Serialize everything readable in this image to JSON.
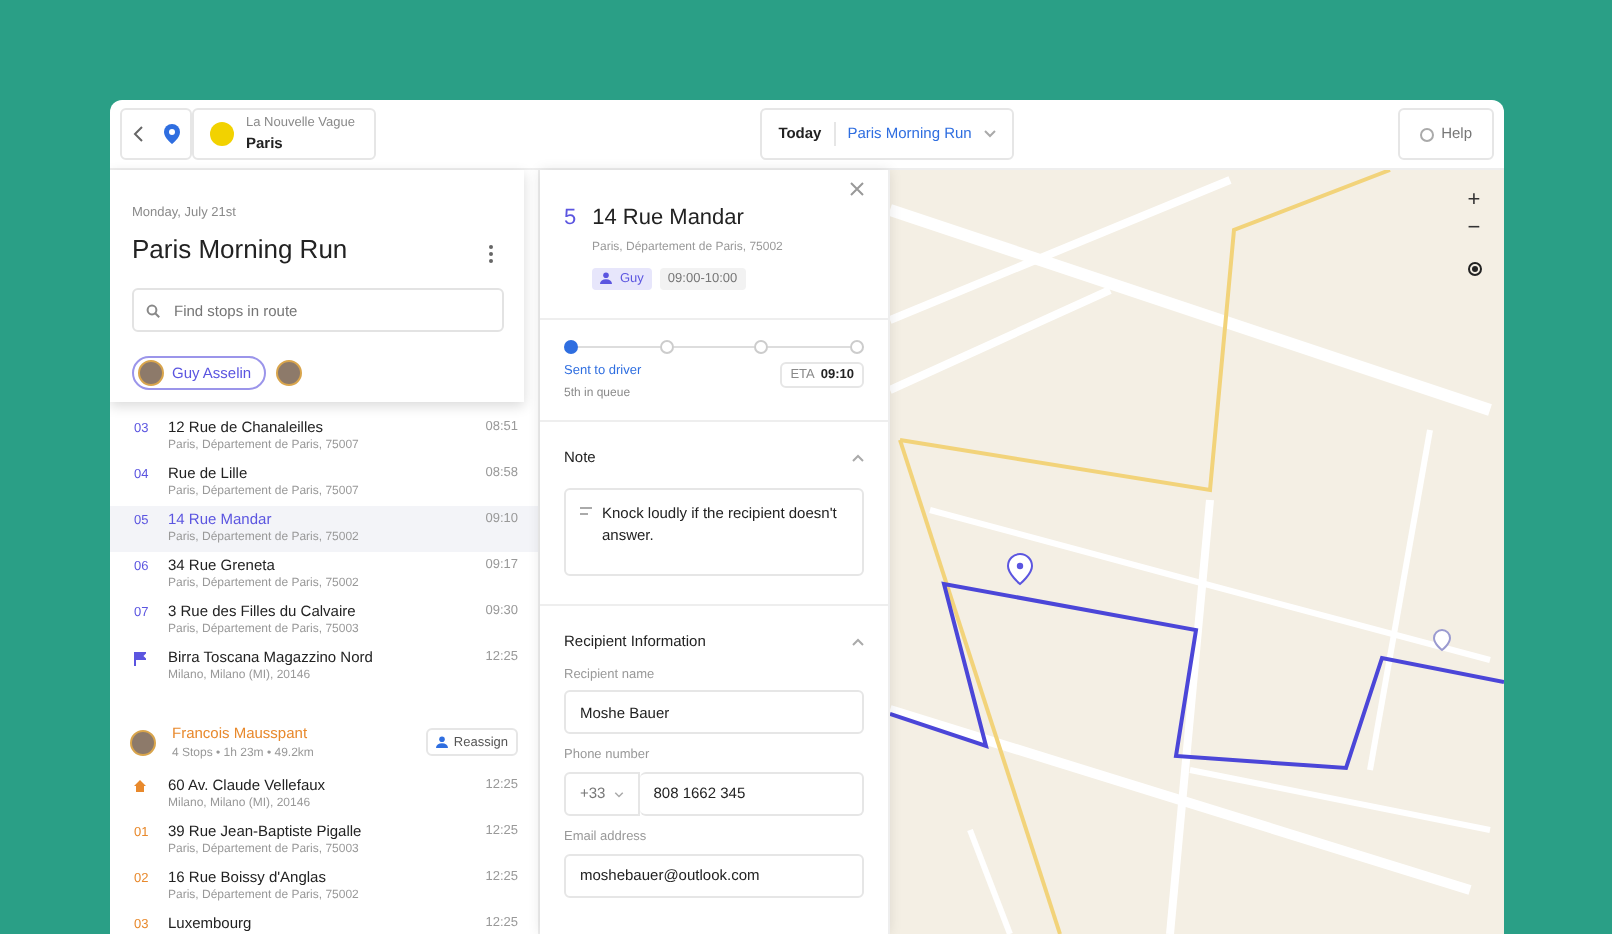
{
  "topbar": {
    "org_name": "La Nouvelle Vague",
    "org_city": "Paris",
    "day": "Today",
    "route_select": "Paris Morning Run",
    "help": "Help"
  },
  "route": {
    "date": "Monday, July 21st",
    "title": "Paris Morning Run",
    "search": {
      "placeholder": "Find stops in route"
    },
    "driver_filter": [
      {
        "label": "Guy Asselin",
        "selected": true
      },
      {
        "selected": false
      }
    ]
  },
  "groups": [
    {
      "color": "#5b55e0",
      "stops": [
        {
          "kind": "stop",
          "number": "03",
          "title": "12 Rue de Chanaleilles",
          "address": "Paris, Département de Paris, 75007",
          "time": "08:51",
          "selected": false
        },
        {
          "kind": "stop",
          "number": "04",
          "title": "Rue de Lille",
          "address": "Paris, Département de Paris, 75007",
          "time": "08:58",
          "selected": false
        },
        {
          "kind": "stop",
          "number": "05",
          "title": "14 Rue Mandar",
          "address": "Paris, Département de Paris, 75002",
          "time": "09:10",
          "selected": true
        },
        {
          "kind": "stop",
          "number": "06",
          "title": "34 Rue Greneta",
          "address": "Paris, Département de Paris, 75002",
          "time": "09:17",
          "selected": false
        },
        {
          "kind": "stop",
          "number": "07",
          "title": "3 Rue des Filles du Calvaire",
          "address": "Paris, Département de Paris, 75003",
          "time": "09:30",
          "selected": false
        },
        {
          "kind": "end",
          "title": "Birra Toscana Magazzino Nord",
          "address": "Milano, Milano (MI), 20146",
          "time": "12:25",
          "selected": false
        }
      ]
    },
    {
      "color": "#e8892c",
      "driver": "Francois Mausspant",
      "summary": "4 Stops • 1h 23m • 49.2km",
      "action": "Reassign",
      "stops": [
        {
          "kind": "start",
          "title": "60 Av. Claude Vellefaux",
          "address": "Milano, Milano (MI), 20146",
          "time": "12:25",
          "selected": false
        },
        {
          "kind": "stop",
          "number": "01",
          "title": "39 Rue Jean-Baptiste Pigalle",
          "address": "Paris, Département de Paris, 75003",
          "time": "12:25",
          "selected": false
        },
        {
          "kind": "stop",
          "number": "02",
          "title": "16 Rue Boissy d'Anglas",
          "address": "Paris, Département de Paris, 75002",
          "time": "12:25",
          "selected": false
        },
        {
          "kind": "stop",
          "number": "03",
          "title": "Luxembourg",
          "time": "12:25",
          "selected": false
        }
      ]
    }
  ],
  "detail": {
    "number": "5",
    "title": "14 Rue Mandar",
    "address": "Paris, Département de Paris, 75002",
    "driver_tag": "Guy",
    "time_window": "09:00-10:00",
    "steps": [
      {
        "done": true
      },
      {
        "done": false
      },
      {
        "done": false
      },
      {
        "done": false
      }
    ],
    "status": "Sent to driver",
    "queue": "5th in queue",
    "eta_label": "ETA",
    "eta": "09:10",
    "note": {
      "title": "Note",
      "expanded": true,
      "text": "Knock loudly if the recipient doesn't answer."
    },
    "recipient": {
      "title": "Recipient Information",
      "expanded": true,
      "fields": [
        {
          "kind": "text",
          "label": "Recipient name",
          "value": "Moshe Bauer"
        },
        {
          "kind": "phone",
          "label": "Phone number",
          "prefix": "+33",
          "value": "808 1662 345"
        },
        {
          "kind": "text",
          "label": "Email address",
          "value": "moshebauer@outlook.com"
        }
      ]
    }
  },
  "map": {
    "zoom": [
      "+",
      "−"
    ]
  }
}
